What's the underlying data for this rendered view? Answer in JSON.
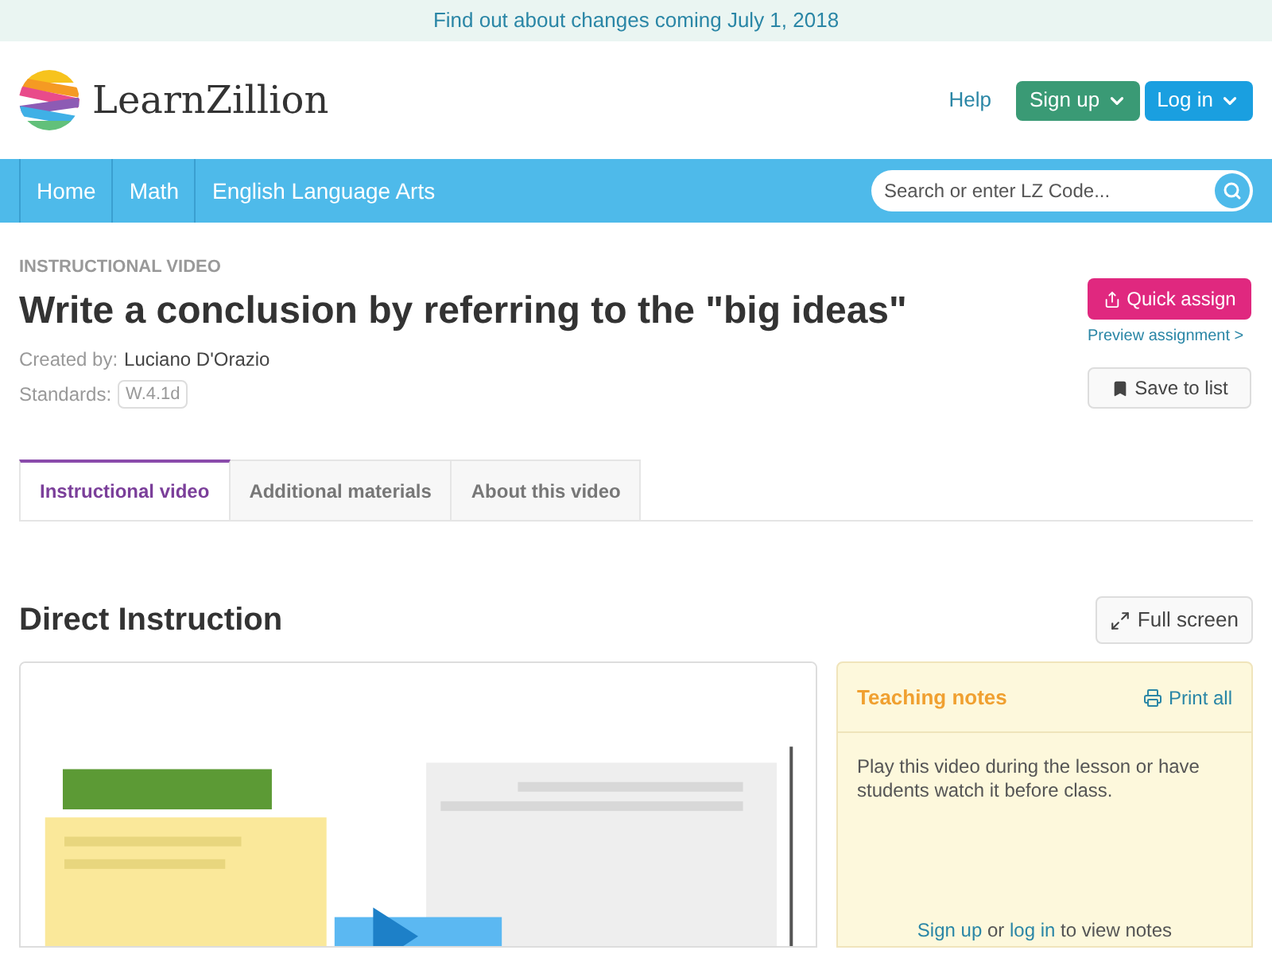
{
  "banner": {
    "text": "Find out about changes coming July 1, 2018"
  },
  "header": {
    "logo_text": "LearnZillion",
    "help": "Help",
    "signup": "Sign up",
    "login": "Log in"
  },
  "nav": {
    "items": [
      {
        "label": "Home"
      },
      {
        "label": "Math"
      },
      {
        "label": "English Language Arts"
      }
    ],
    "search": {
      "placeholder": "Search or enter LZ Code..."
    }
  },
  "lesson": {
    "kind_label": "INSTRUCTIONAL VIDEO",
    "title": "Write a conclusion by referring to the \"big ideas\"",
    "created_label": "Created by:",
    "author": "Luciano D'Orazio",
    "standards_label": "Standards:",
    "standard": "W.4.1d",
    "quick_assign": "Quick assign",
    "preview": "Preview assignment >",
    "save": "Save to list"
  },
  "tabs": [
    {
      "label": "Instructional video",
      "selected": true
    },
    {
      "label": "Additional materials",
      "selected": false
    },
    {
      "label": "About this video",
      "selected": false
    }
  ],
  "section": {
    "title": "Direct Instruction",
    "fullscreen": "Full screen"
  },
  "notes": {
    "title": "Teaching notes",
    "print": "Print all",
    "body": "Play this video during the lesson or have students watch it before class.",
    "signup_link": "Sign up",
    "or": "or",
    "login_link": "log in",
    "tail": "to view notes"
  }
}
